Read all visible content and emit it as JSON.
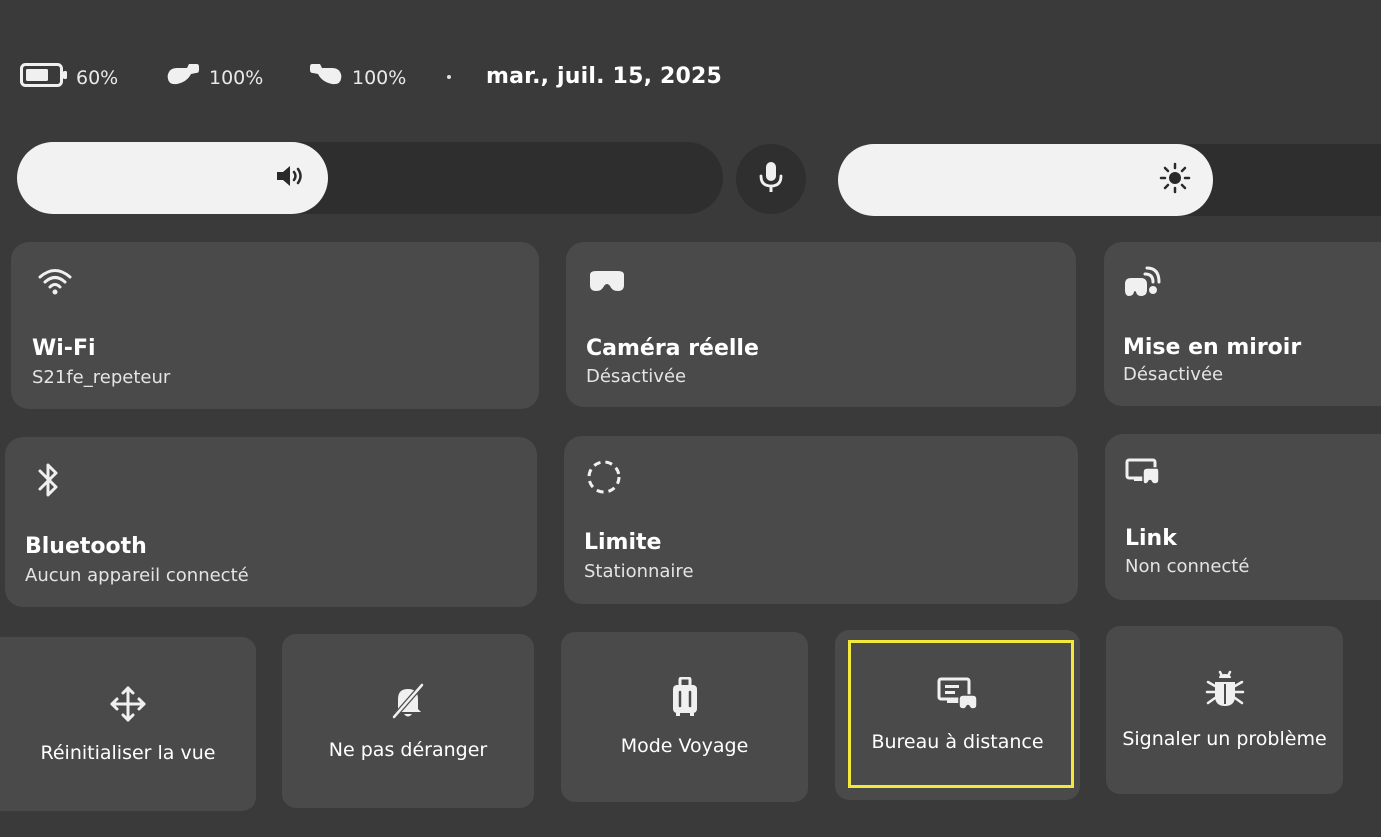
{
  "status": {
    "headset_battery": "60%",
    "left_controller": "100%",
    "right_controller": "100%",
    "date": "mar., juil. 15, 2025"
  },
  "sliders": {
    "volume_level": 0.44,
    "brightness_level": 0.69
  },
  "tiles": {
    "wifi": {
      "title": "Wi-Fi",
      "subtitle": "S21fe_repeteur"
    },
    "camera": {
      "title": "Caméra réelle",
      "subtitle": "Désactivée"
    },
    "mirror": {
      "title": "Mise en miroir",
      "subtitle": "Désactivée"
    },
    "bluetooth": {
      "title": "Bluetooth",
      "subtitle": "Aucun appareil connecté"
    },
    "boundary": {
      "title": "Limite",
      "subtitle": "Stationnaire"
    },
    "link": {
      "title": "Link",
      "subtitle": "Non connecté"
    }
  },
  "actions": {
    "reset_view": "Réinitialiser la vue",
    "do_not_disturb": "Ne pas déranger",
    "travel_mode": "Mode Voyage",
    "remote_desktop": "Bureau à distance",
    "report_problem": "Signaler un problème"
  },
  "colors": {
    "background": "#3a3a3a",
    "tile": "#4a4a4a",
    "slider_fill": "#f2f2f2",
    "highlight": "#f2e93a"
  }
}
